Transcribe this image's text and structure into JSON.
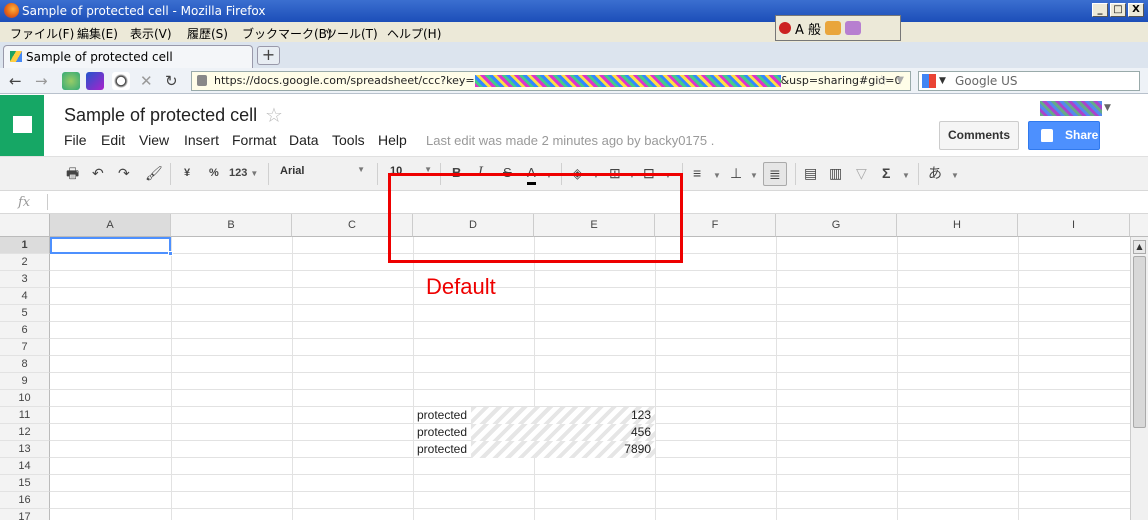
{
  "window": {
    "title": "Sample of protected cell - Mozilla Firefox",
    "min": "_",
    "max": "□",
    "close": "X"
  },
  "menubar": [
    "ファイル(F)",
    "編集(E)",
    "表示(V)",
    "履歴(S)",
    "ブックマーク(B)",
    "ツール(T)",
    "ヘルプ(H)"
  ],
  "ime": {
    "label": "A 般"
  },
  "tab": {
    "label": "Sample of protected cell",
    "new": "+"
  },
  "nav": {
    "back": "←",
    "forward": "→",
    "stop": "✕",
    "reload": "↻",
    "url_prefix": "https://docs.google.com/spreadsheet/ccc?key=",
    "url_suffix": "&usp=sharing#gid=0",
    "search_placeholder": "Google US"
  },
  "doc": {
    "title": "Sample of protected cell",
    "star": "☆",
    "menu": [
      "File",
      "Edit",
      "View",
      "Insert",
      "Format",
      "Data",
      "Tools",
      "Help"
    ],
    "last_edit": "Last edit was made 2 minutes ago by backy0175 .",
    "comments": "Comments",
    "share": "Share"
  },
  "toolbar": {
    "print": "🖶",
    "undo": "↶",
    "redo": "↷",
    "paint": "🖌",
    "currency": "¥",
    "percent": "%",
    "number_format": "123",
    "font": "Arial",
    "size": "10",
    "bold": "B",
    "italic": "I",
    "strike": "S",
    "textcolor": "A",
    "fill": "◈",
    "borders": "⊞",
    "merge": "⊟",
    "align": "≡",
    "valign": "⊥",
    "wrap": "≣",
    "comment": "▤",
    "chart": "▥",
    "filter": "▽",
    "functions": "Σ",
    "input": "あ"
  },
  "formula": {
    "fx": "fx",
    "value": ""
  },
  "grid": {
    "columns": [
      "A",
      "B",
      "C",
      "D",
      "E",
      "F",
      "G",
      "H",
      "I"
    ],
    "rows": [
      "1",
      "2",
      "3",
      "4",
      "5",
      "6",
      "7",
      "8",
      "9",
      "10",
      "11",
      "12",
      "13",
      "14",
      "15",
      "16",
      "17"
    ],
    "cells": [
      {
        "label": "protected",
        "value": "123"
      },
      {
        "label": "protected",
        "value": "456"
      },
      {
        "label": "protected",
        "value": "7890"
      }
    ]
  },
  "annotation": {
    "caption": "Default",
    "color": "#ee0000"
  },
  "colors": {
    "sheets_green": "#16a765",
    "share_blue": "#4d90fe",
    "selection": "#4d90fe"
  }
}
